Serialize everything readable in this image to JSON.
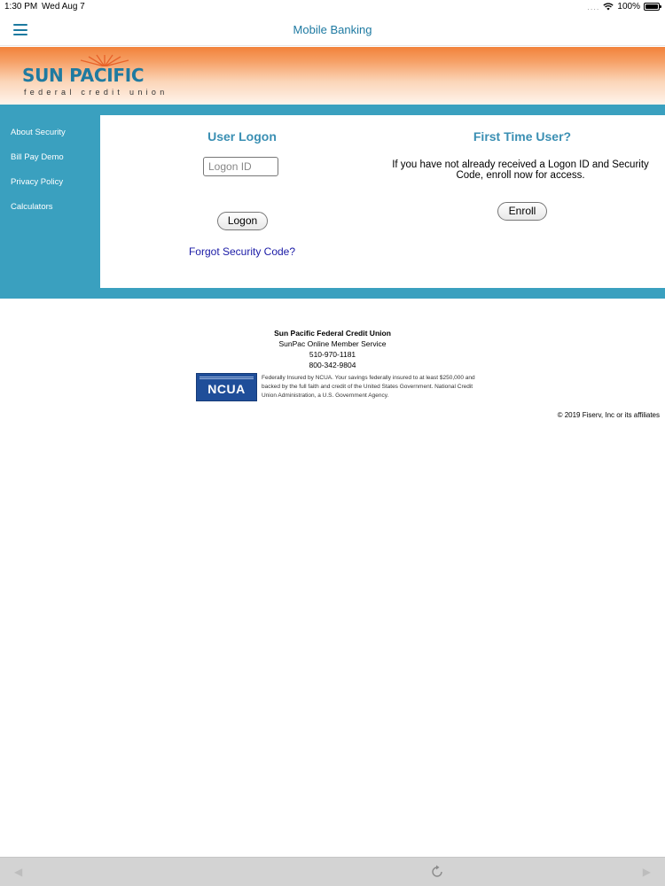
{
  "status_bar": {
    "time": "1:30 PM",
    "date": "Wed Aug 7",
    "signal": "....",
    "battery": "100%"
  },
  "header": {
    "title": "Mobile Banking",
    "menu_icon": "hamburger-icon"
  },
  "logo": {
    "name": "SUN PACIFIC",
    "tagline": "federal credit union"
  },
  "sidebar": {
    "items": [
      {
        "label": "About Security"
      },
      {
        "label": "Bill Pay Demo"
      },
      {
        "label": "Privacy Policy"
      },
      {
        "label": "Calculators"
      }
    ]
  },
  "logon": {
    "title": "User Logon",
    "input_placeholder": "Logon ID",
    "input_value": "",
    "button_label": "Logon",
    "forgot_link": "Forgot Security Code?"
  },
  "first_time": {
    "title": "First Time User?",
    "text": "If you have not already received a Logon ID and Security Code, enroll now for access.",
    "button_label": "Enroll"
  },
  "footer": {
    "org_name": "Sun Pacific Federal Credit Union",
    "service": "SunPac Online Member Service",
    "phone1": "510-970-1181",
    "phone2": "800-342-9804",
    "ncua_badge": "NCUA",
    "ncua_text": "Federally Insured by NCUA. Your savings federally insured to at least $250,000 and backed by the full faith and credit of the United States Government. National Credit Union Administration, a U.S. Government Agency.",
    "copyright": "© 2019 Fiserv, Inc or its affiliates"
  },
  "toolbar": {
    "back_icon": "back-arrow-icon",
    "refresh_icon": "refresh-icon",
    "forward_icon": "forward-arrow-icon"
  },
  "colors": {
    "accent": "#1d79a1",
    "band": "#3aa0bf",
    "banner_orange": "#f2823a",
    "link": "#1a1aa6",
    "ncua_blue": "#1f4e99"
  }
}
